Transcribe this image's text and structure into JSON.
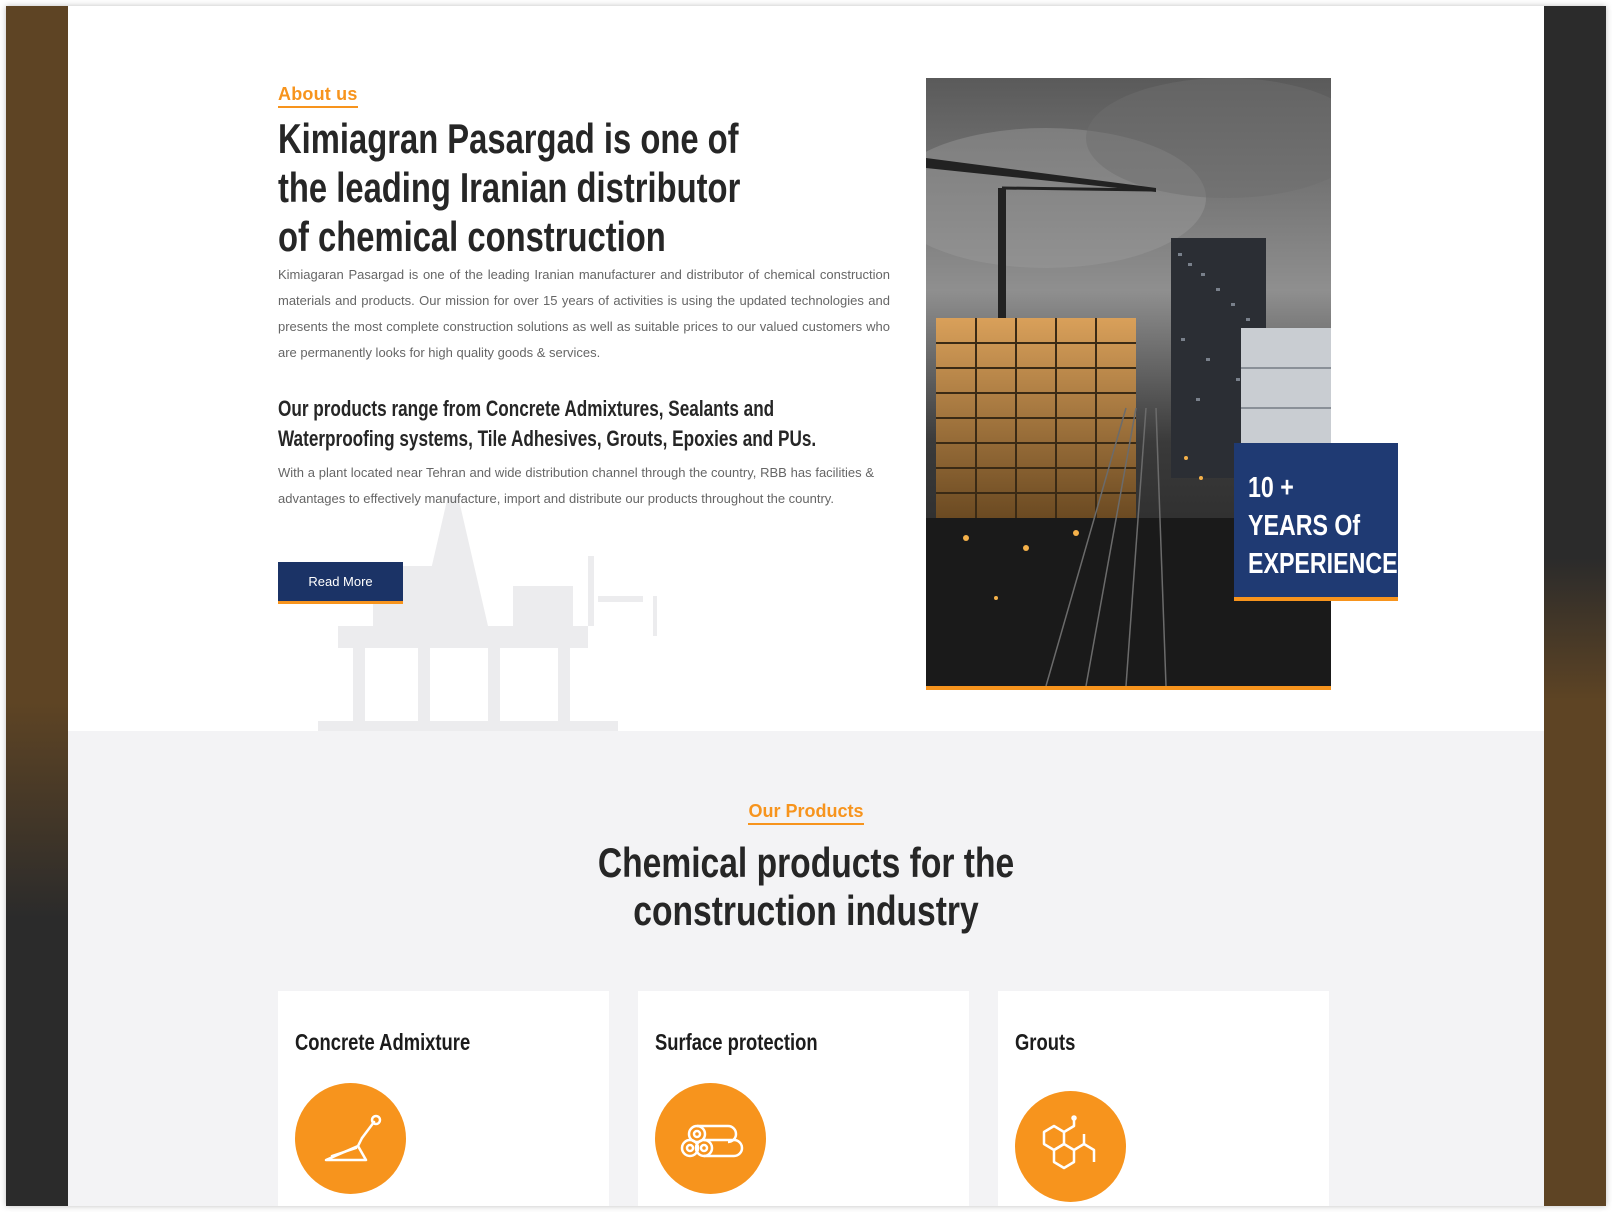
{
  "about": {
    "tag": "About us",
    "heading_lines": [
      "Kimiagran Pasargad is one of",
      "the leading Iranian distributor",
      "of chemical construction"
    ],
    "paragraph": "Kimiagaran Pasargad is one of the leading Iranian manufacturer and distributor of chemical construction materials and products. Our mission for over 15 years of activities is using the updated technologies and presents the most complete construction solutions as well as suitable prices to our valued customers who are permanently looks for high quality goods & services.",
    "subheading_lines": [
      "Our products range from Concrete Admixtures, Sealants and",
      "Waterproofing systems, Tile Adhesives, Grouts, Epoxies and PUs."
    ],
    "paragraph2": "With a plant located near Tehran and wide distribution channel through the country, RBB has facilities & advantages to effectively manufacture, import and distribute our products throughout the country.",
    "button_label": "Read More",
    "experience_lines": [
      "10 +",
      "YEARS Of",
      "EXPERIENCE"
    ]
  },
  "products": {
    "tag": "Our Products",
    "heading_lines": [
      "Chemical products for the",
      "construction industry"
    ],
    "cards": [
      {
        "title": "Concrete Admixture",
        "icon": "trowel-icon"
      },
      {
        "title": "Surface protection",
        "icon": "pipes-icon"
      },
      {
        "title": "Grouts",
        "icon": "molecule-icon"
      }
    ]
  },
  "colors": {
    "accent": "#f7941d",
    "navy": "#1b3366",
    "text": "#262626",
    "muted": "#666666",
    "section_bg": "#f3f3f5"
  }
}
